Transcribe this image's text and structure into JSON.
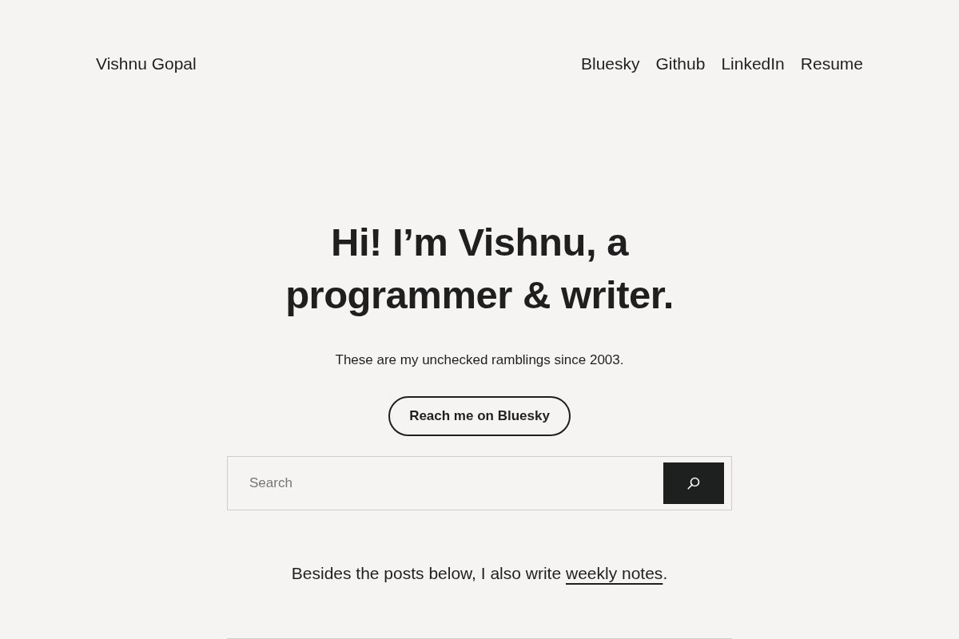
{
  "header": {
    "site_title": "Vishnu Gopal",
    "nav": [
      "Bluesky",
      "Github",
      "LinkedIn",
      "Resume"
    ]
  },
  "hero": {
    "heading": "Hi! I’m Vishnu, a programmer & writer.",
    "subtitle": "These are my unchecked ramblings since 2003.",
    "button": "Reach me on Bluesky"
  },
  "search": {
    "placeholder": "Search"
  },
  "intro": {
    "before": "Besides the posts below, I also write",
    "link": "weekly notes",
    "after": "."
  }
}
